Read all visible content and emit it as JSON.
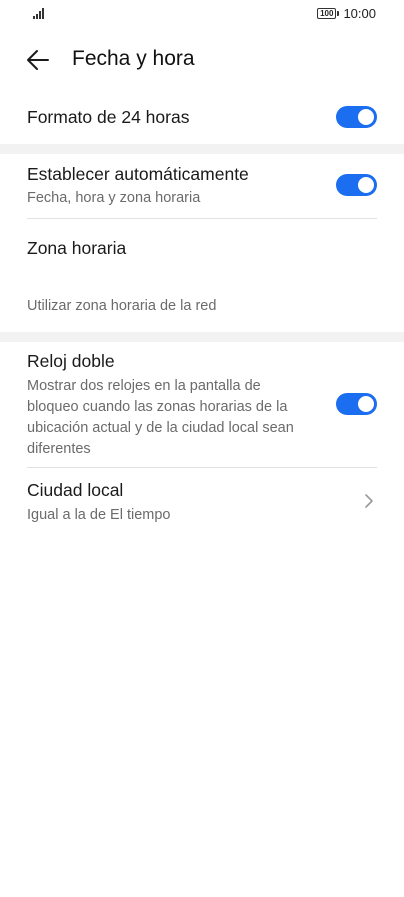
{
  "status_bar": {
    "battery": "100",
    "time": "10:00"
  },
  "header": {
    "title": "Fecha y hora"
  },
  "settings": {
    "format24": {
      "label": "Formato de 24 horas",
      "enabled": true
    },
    "auto_set": {
      "label": "Establecer automáticamente",
      "sub": "Fecha, hora y zona horaria",
      "enabled": true
    },
    "timezone": {
      "label": "Zona horaria"
    },
    "network_tz": {
      "label": "Utilizar zona horaria de la red"
    },
    "dual_clock": {
      "label": "Reloj doble",
      "sub_lines": [
        "Mostrar dos relojes en la pantalla de",
        "bloqueo cuando las zonas horarias de la",
        "ubicación actual y de la ciudad local sean",
        "diferentes"
      ],
      "enabled": true
    },
    "home_city": {
      "label": "Ciudad local",
      "sub": "Igual a la de El tiempo"
    }
  },
  "colors": {
    "accent": "#1b6ef0",
    "section_gap": "#f2f2f2"
  }
}
